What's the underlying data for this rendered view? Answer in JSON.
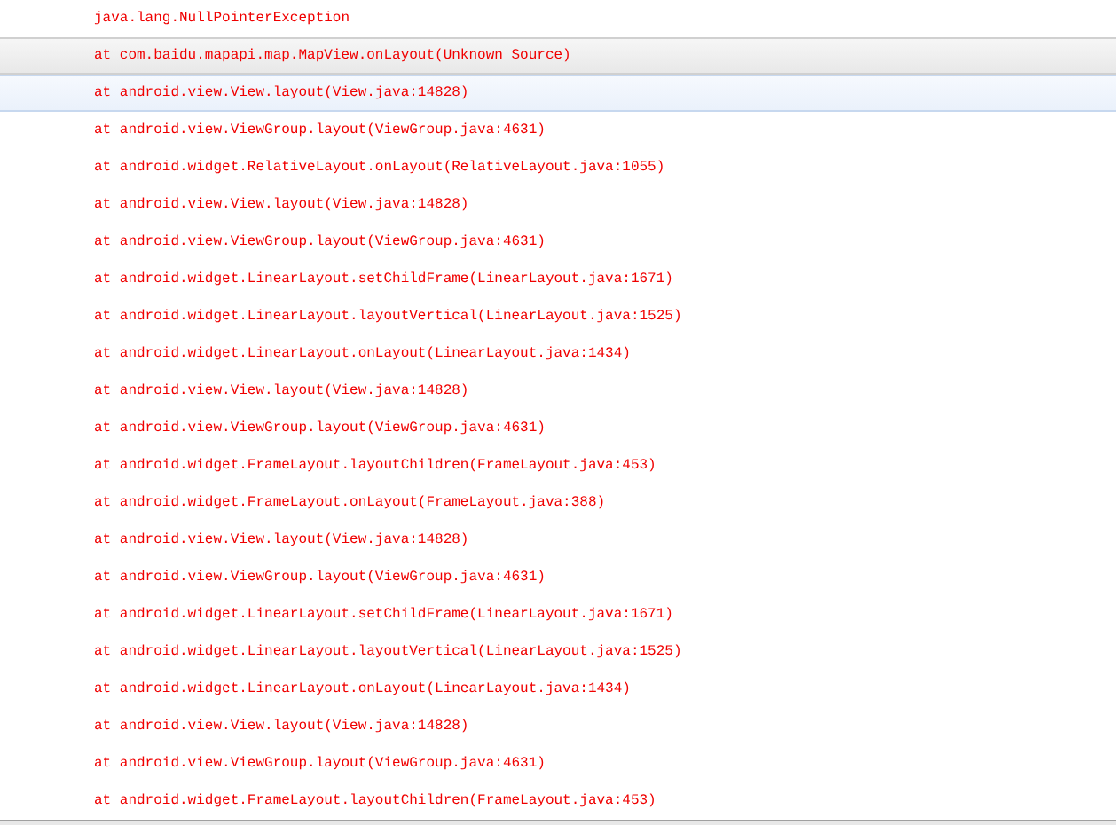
{
  "log_rows": [
    {
      "text": "java.lang.NullPointerException",
      "hovered": false,
      "selected": false
    },
    {
      "text": "at com.baidu.mapapi.map.MapView.onLayout(Unknown Source)",
      "hovered": true,
      "selected": false
    },
    {
      "text": "at android.view.View.layout(View.java:14828)",
      "hovered": false,
      "selected": true
    },
    {
      "text": "at android.view.ViewGroup.layout(ViewGroup.java:4631)",
      "hovered": false,
      "selected": false
    },
    {
      "text": "at android.widget.RelativeLayout.onLayout(RelativeLayout.java:1055)",
      "hovered": false,
      "selected": false
    },
    {
      "text": "at android.view.View.layout(View.java:14828)",
      "hovered": false,
      "selected": false
    },
    {
      "text": "at android.view.ViewGroup.layout(ViewGroup.java:4631)",
      "hovered": false,
      "selected": false
    },
    {
      "text": "at android.widget.LinearLayout.setChildFrame(LinearLayout.java:1671)",
      "hovered": false,
      "selected": false
    },
    {
      "text": "at android.widget.LinearLayout.layoutVertical(LinearLayout.java:1525)",
      "hovered": false,
      "selected": false
    },
    {
      "text": "at android.widget.LinearLayout.onLayout(LinearLayout.java:1434)",
      "hovered": false,
      "selected": false
    },
    {
      "text": "at android.view.View.layout(View.java:14828)",
      "hovered": false,
      "selected": false
    },
    {
      "text": "at android.view.ViewGroup.layout(ViewGroup.java:4631)",
      "hovered": false,
      "selected": false
    },
    {
      "text": "at android.widget.FrameLayout.layoutChildren(FrameLayout.java:453)",
      "hovered": false,
      "selected": false
    },
    {
      "text": "at android.widget.FrameLayout.onLayout(FrameLayout.java:388)",
      "hovered": false,
      "selected": false
    },
    {
      "text": "at android.view.View.layout(View.java:14828)",
      "hovered": false,
      "selected": false
    },
    {
      "text": "at android.view.ViewGroup.layout(ViewGroup.java:4631)",
      "hovered": false,
      "selected": false
    },
    {
      "text": "at android.widget.LinearLayout.setChildFrame(LinearLayout.java:1671)",
      "hovered": false,
      "selected": false
    },
    {
      "text": "at android.widget.LinearLayout.layoutVertical(LinearLayout.java:1525)",
      "hovered": false,
      "selected": false
    },
    {
      "text": "at android.widget.LinearLayout.onLayout(LinearLayout.java:1434)",
      "hovered": false,
      "selected": false
    },
    {
      "text": "at android.view.View.layout(View.java:14828)",
      "hovered": false,
      "selected": false
    },
    {
      "text": "at android.view.ViewGroup.layout(ViewGroup.java:4631)",
      "hovered": false,
      "selected": false
    },
    {
      "text": "at android.widget.FrameLayout.layoutChildren(FrameLayout.java:453)",
      "hovered": false,
      "selected": false
    }
  ]
}
